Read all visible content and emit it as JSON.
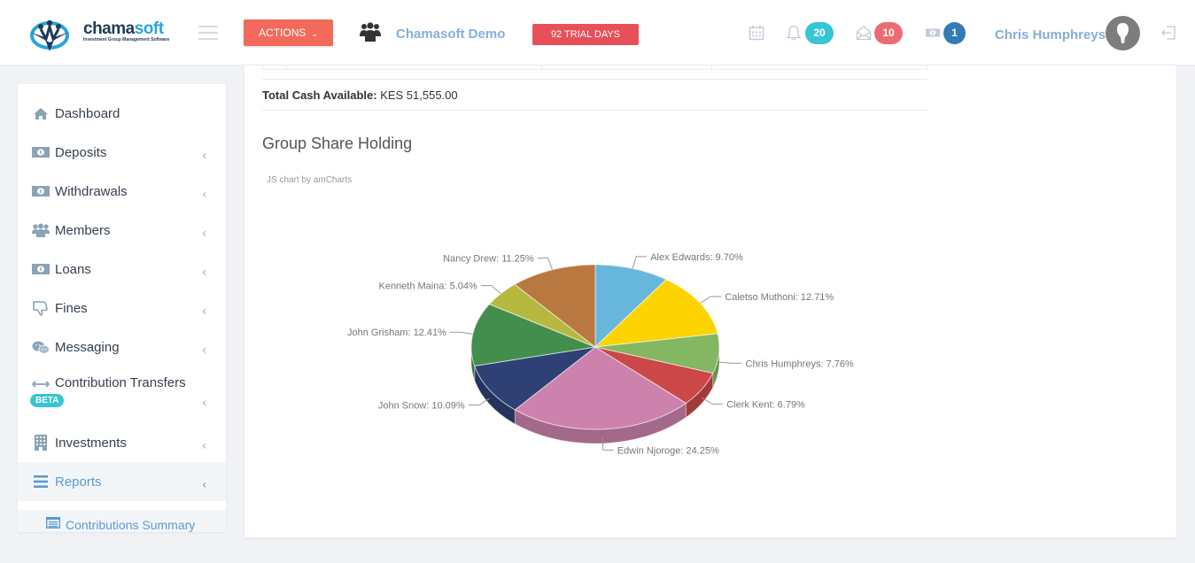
{
  "header": {
    "logo_brand_a": "chama",
    "logo_brand_b": "soft",
    "logo_tagline": "Investment Group Management Software",
    "actions_label": "ACTIONS",
    "group_name": "Chamasoft Demo",
    "trial_label": "92 TRIAL DAYS",
    "notifications_count": "20",
    "messages_count": "10",
    "payments_count": "1",
    "user_name": "Chris Humphreys",
    "colors": {
      "actions": "#f36a5a",
      "trial": "#e7505a",
      "notifications_badge": "#36c6d3",
      "messages_badge": "#ed6b75",
      "payments_badge": "#337ab7"
    }
  },
  "sidebar": {
    "items": [
      {
        "label": "Dashboard",
        "icon": "home-icon",
        "has_arrow": false
      },
      {
        "label": "Deposits",
        "icon": "money-icon",
        "has_arrow": true
      },
      {
        "label": "Withdrawals",
        "icon": "money-icon",
        "has_arrow": true
      },
      {
        "label": "Members",
        "icon": "users-icon",
        "has_arrow": true
      },
      {
        "label": "Loans",
        "icon": "money-icon",
        "has_arrow": true
      },
      {
        "label": "Fines",
        "icon": "thumbs-down-icon",
        "has_arrow": true
      },
      {
        "label": "Messaging",
        "icon": "chat-icon",
        "has_arrow": true
      },
      {
        "label": "Contribution Transfers",
        "icon": "arrows-h-icon",
        "has_arrow": true,
        "badge": "BETA"
      },
      {
        "label": "Investments",
        "icon": "building-icon",
        "has_arrow": true
      },
      {
        "label": "Reports",
        "icon": "bars-icon",
        "has_arrow": true,
        "active": true
      }
    ],
    "sub_items": [
      {
        "label": "Contributions Summary",
        "icon": "list-alt-icon"
      }
    ],
    "arrow_glyph": "‹"
  },
  "main": {
    "total_cash_label": "Total Cash Available:",
    "total_cash_value": "KES 51,555.00",
    "section_title": "Group Share Holding",
    "chart_credit": "JS chart by amCharts"
  },
  "chart_data": {
    "type": "pie",
    "title": "Group Share Holding",
    "style": "3d",
    "start": "top",
    "direction": "clockwise",
    "slices": [
      {
        "label": "Alex Edwards",
        "value": 9.7,
        "color": "#67b7dc"
      },
      {
        "label": "Caletso Muthoni",
        "value": 12.71,
        "color": "#fdd400"
      },
      {
        "label": "Chris Humphreys",
        "value": 7.76,
        "color": "#84b761"
      },
      {
        "label": "Clerk Kent",
        "value": 6.79,
        "color": "#cc4748"
      },
      {
        "label": "Edwin Njoroge",
        "value": 24.25,
        "color": "#cd82ad"
      },
      {
        "label": "John Snow",
        "value": 10.09,
        "color": "#2f4074"
      },
      {
        "label": "John Grisham",
        "value": 12.41,
        "color": "#448e4d"
      },
      {
        "label": "Kenneth Maina",
        "value": 5.04,
        "color": "#b7b83f"
      },
      {
        "label": "Nancy Drew",
        "value": 11.25,
        "color": "#b9783f"
      }
    ],
    "label_format": "{label}: {value}%"
  }
}
